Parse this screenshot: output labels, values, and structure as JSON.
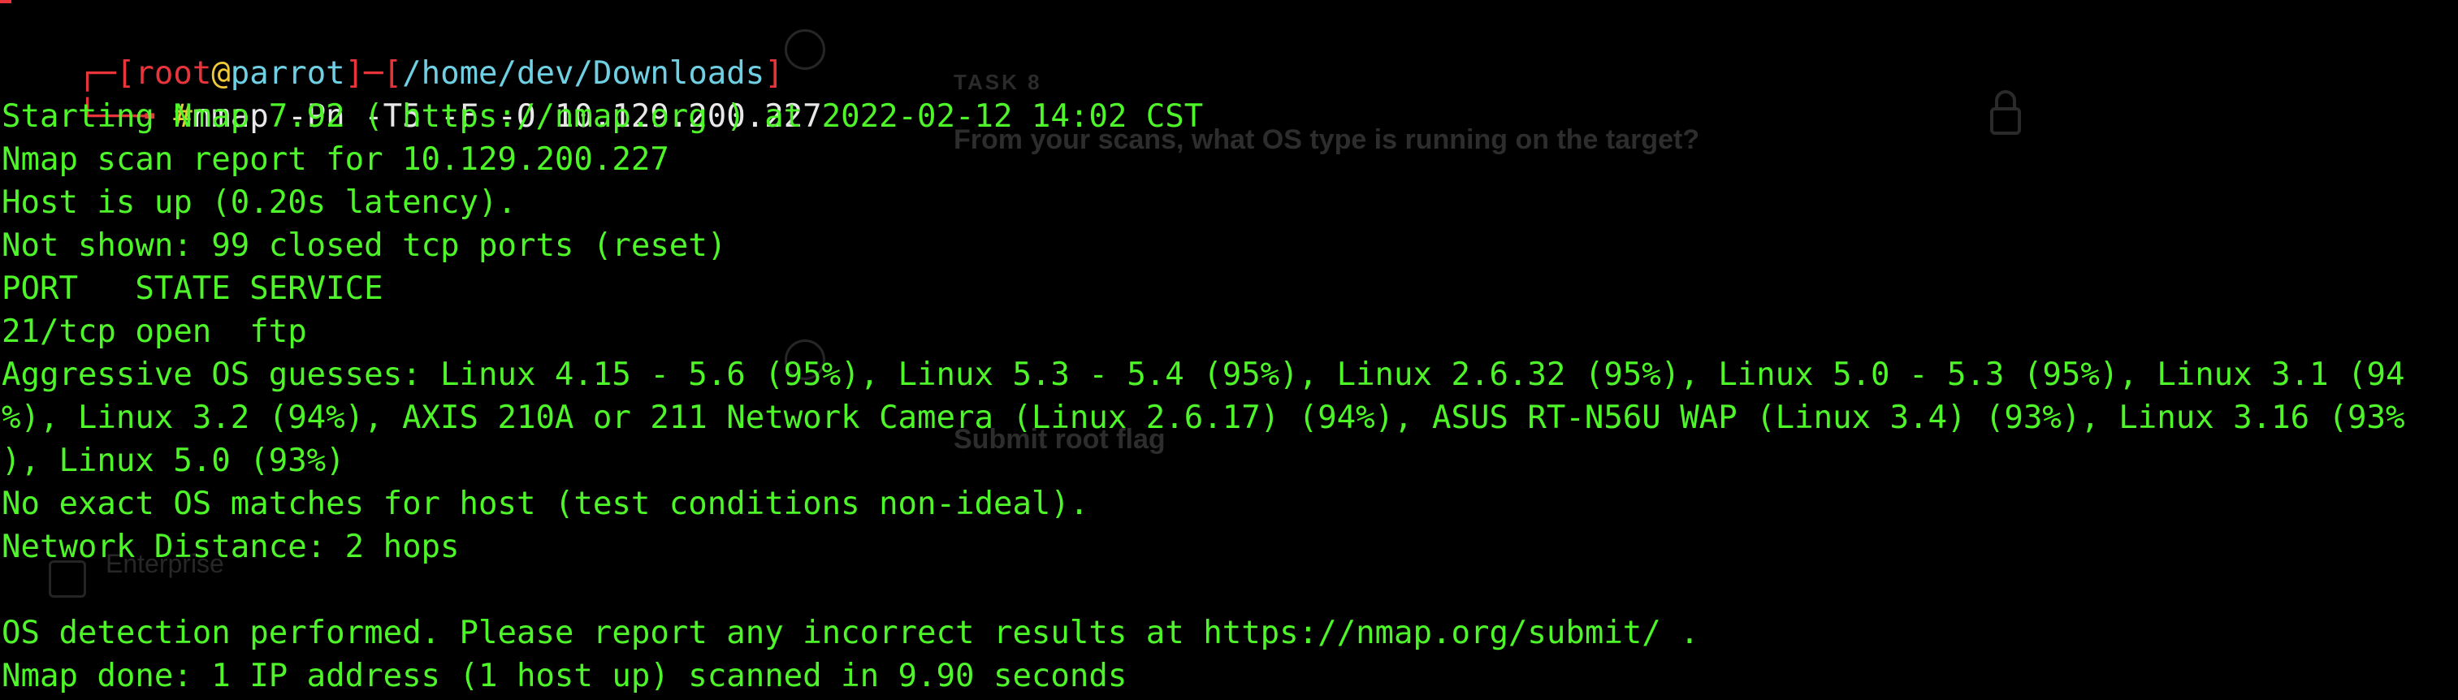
{
  "background_page": {
    "task_label": "TASK 8",
    "question": "From your scans, what OS type is running on the target?",
    "submit_label": "Submit root flag",
    "sidebar_item": "Enterprise"
  },
  "prompt": {
    "user": "root",
    "at": "@",
    "host": "parrot",
    "path": "/home/dev/Downloads",
    "symbol": "#",
    "command": "nmap -Pn -T5 -F -O 10.129.200.227"
  },
  "output_lines": [
    "Starting Nmap 7.92 ( https://nmap.org ) at 2022-02-12 14:02 CST",
    "Nmap scan report for 10.129.200.227",
    "Host is up (0.20s latency).",
    "Not shown: 99 closed tcp ports (reset)",
    "PORT   STATE SERVICE",
    "21/tcp open  ftp",
    "Aggressive OS guesses: Linux 4.15 - 5.6 (95%), Linux 5.3 - 5.4 (95%), Linux 2.6.32 (95%), Linux 5.0 - 5.3 (95%), Linux 3.1 (94",
    "%), Linux 3.2 (94%), AXIS 210A or 211 Network Camera (Linux 2.6.17) (94%), ASUS RT-N56U WAP (Linux 3.4) (93%), Linux 3.16 (93%",
    "), Linux 5.0 (93%)",
    "No exact OS matches for host (test conditions non-ideal).",
    "Network Distance: 2 hops",
    "",
    "OS detection performed. Please report any incorrect results at https://nmap.org/submit/ .",
    "Nmap done: 1 IP address (1 host up) scanned in 9.90 seconds"
  ],
  "colors": {
    "background": "#000000",
    "output_green": "#4ef529",
    "prompt_red": "#e8343a",
    "prompt_yellow": "#f0c93a",
    "prompt_cyan": "#6fd0e3"
  }
}
